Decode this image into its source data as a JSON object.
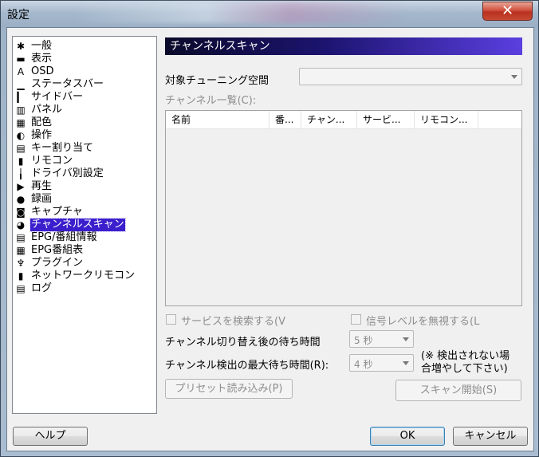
{
  "window": {
    "title": "設定",
    "close_glyph": "✕"
  },
  "tree": {
    "items": [
      {
        "icon": "gear-icon",
        "glyph": "✱",
        "label": "一般"
      },
      {
        "icon": "display-icon",
        "glyph": "▬",
        "label": "表示"
      },
      {
        "icon": "osd-icon",
        "glyph": "A",
        "label": "OSD"
      },
      {
        "icon": "statusbar-icon",
        "glyph": "▁",
        "label": "ステータスバー"
      },
      {
        "icon": "sidebar-icon",
        "glyph": "▎",
        "label": "サイドバー"
      },
      {
        "icon": "panel-icon",
        "glyph": "▥",
        "label": "パネル"
      },
      {
        "icon": "palette-icon",
        "glyph": "▦",
        "label": "配色"
      },
      {
        "icon": "mouse-icon",
        "glyph": "◐",
        "label": "操作"
      },
      {
        "icon": "keyboard-icon",
        "glyph": "▤",
        "label": "キー割り当て"
      },
      {
        "icon": "remote-icon",
        "glyph": "▮",
        "label": "リモコン"
      },
      {
        "icon": "driver-icon",
        "glyph": "╽",
        "label": "ドライバ別設定"
      },
      {
        "icon": "play-icon",
        "glyph": "▶",
        "label": "再生"
      },
      {
        "icon": "record-icon",
        "glyph": "●",
        "label": "録画"
      },
      {
        "icon": "camera-icon",
        "glyph": "◙",
        "label": "キャプチャ"
      },
      {
        "icon": "channel-scan-icon",
        "glyph": "◕",
        "label": "チャンネルスキャン"
      },
      {
        "icon": "epg-icon",
        "glyph": "▤",
        "label": "EPG/番組情報"
      },
      {
        "icon": "epg-table-icon",
        "glyph": "▦",
        "label": "EPG番組表"
      },
      {
        "icon": "plugin-icon",
        "glyph": "♆",
        "label": "プラグイン"
      },
      {
        "icon": "network-remote-icon",
        "glyph": "▮",
        "label": "ネットワークリモコン"
      },
      {
        "icon": "log-icon",
        "glyph": "▤",
        "label": "ログ"
      }
    ],
    "selected_index": 14
  },
  "panel": {
    "header": "チャンネルスキャン",
    "tuning_space_label": "対象チューニング空間",
    "tuning_space_value": "",
    "channel_list_label": "チャンネル一覧(C):",
    "columns": [
      "名前",
      "番...",
      "チャン...",
      "サービ...",
      "リモコン..."
    ],
    "search_services_label": "サービスを検索する(V",
    "ignore_signal_label": "信号レベルを無視する(L",
    "wait_time_label": "チャンネル切り替え後の待ち時間",
    "wait_time_value": "5 秒",
    "max_wait_label": "チャンネル検出の最大待ち時間(R):",
    "max_wait_value": "4 秒",
    "note_line1": "(※ 検出されない場",
    "note_line2": "合増やして下さい)",
    "preset_button": "プリセット読み込み(P)",
    "scan_button": "スキャン開始(S)"
  },
  "footer": {
    "help_button": "ヘルプ",
    "ok_button": "OK",
    "cancel_button": "キャンセル"
  }
}
